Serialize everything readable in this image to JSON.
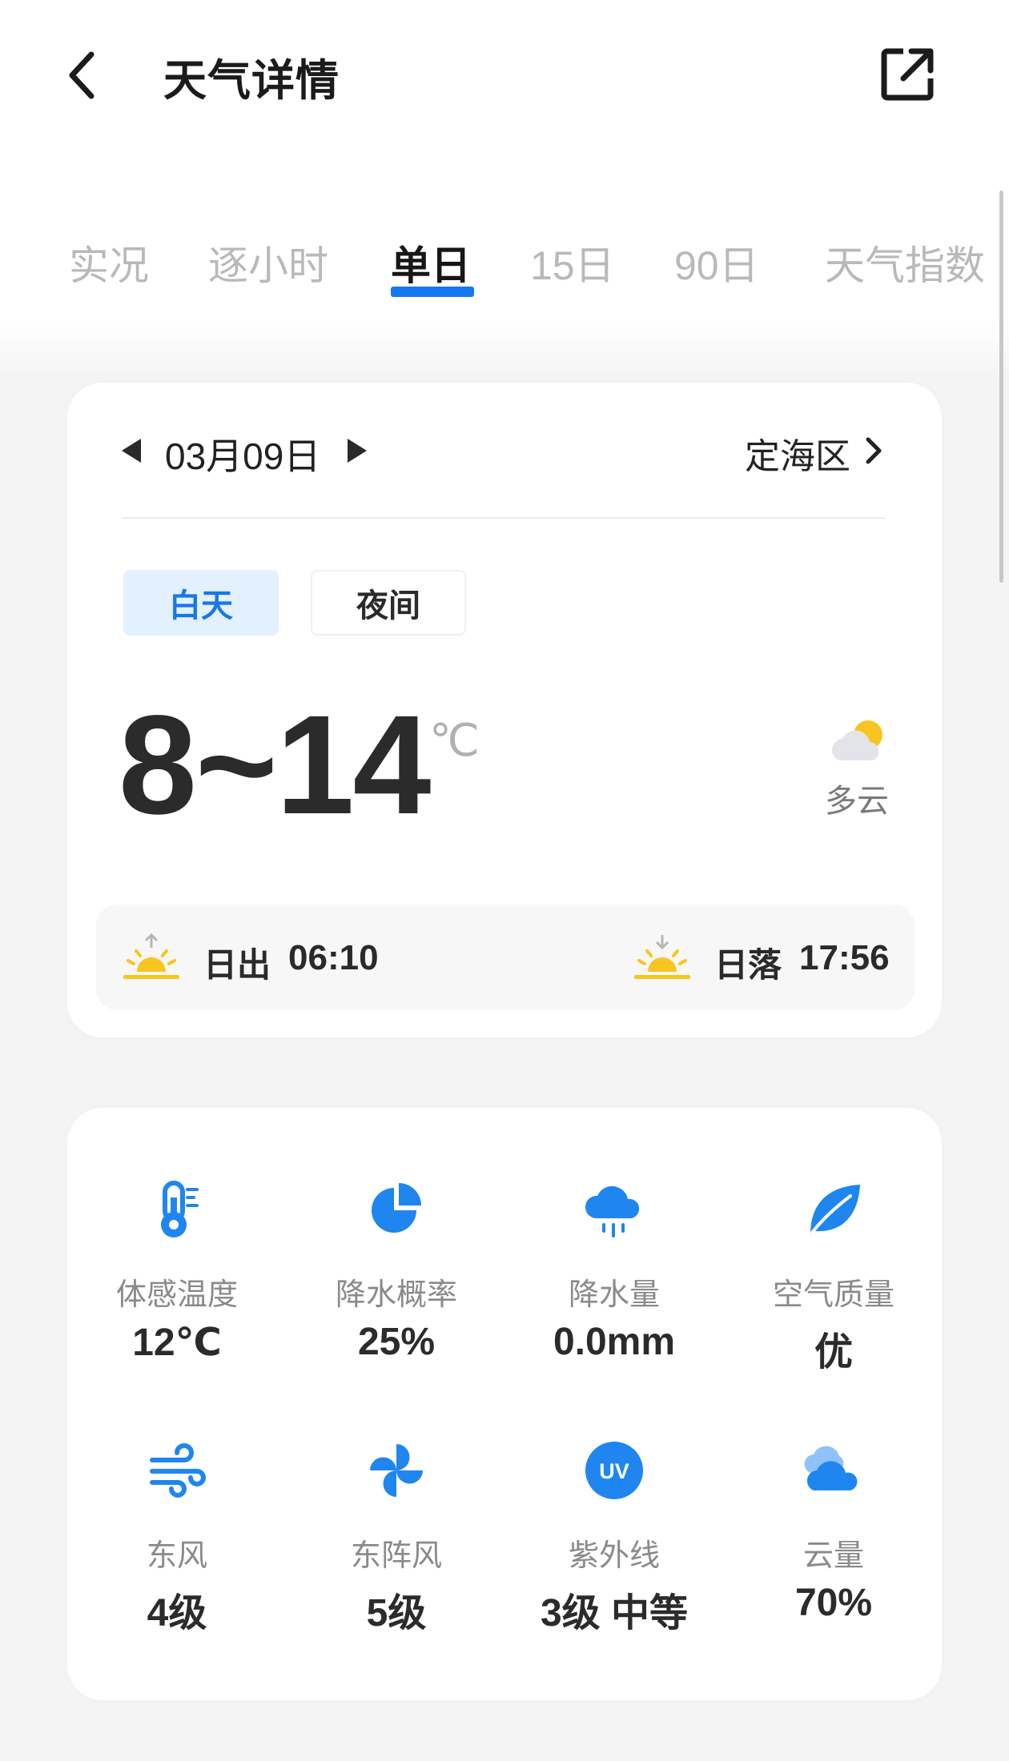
{
  "header": {
    "title": "天气详情"
  },
  "tabs": [
    {
      "label": "实况"
    },
    {
      "label": "逐小时"
    },
    {
      "label": "单日",
      "active": true
    },
    {
      "label": "15日"
    },
    {
      "label": "90日"
    },
    {
      "label": "天气指数"
    }
  ],
  "day_card": {
    "date": "03月09日",
    "location": "定海区",
    "segments": {
      "day": "白天",
      "night": "夜间",
      "selected": "白天"
    },
    "temperature_range": "8~14",
    "unit": "℃",
    "condition": "多云",
    "condition_icon": "partly-cloudy-icon",
    "sunrise": {
      "label": "日出",
      "time": "06:10"
    },
    "sunset": {
      "label": "日落",
      "time": "17:56"
    }
  },
  "details": [
    {
      "label": "体感温度",
      "value": "12℃",
      "icon": "thermometer-icon"
    },
    {
      "label": "降水概率",
      "value": "25%",
      "icon": "pie-chart-icon"
    },
    {
      "label": "降水量",
      "value": "0.0mm",
      "icon": "rain-cloud-icon"
    },
    {
      "label": "空气质量",
      "value": "优",
      "icon": "leaf-icon"
    },
    {
      "label": "东风",
      "value": "4级",
      "icon": "wind-icon"
    },
    {
      "label": "东阵风",
      "value": "5级",
      "icon": "pinwheel-icon"
    },
    {
      "label": "紫外线",
      "value": "3级 中等",
      "icon": "uv-icon",
      "uv_text": "UV"
    },
    {
      "label": "云量",
      "value": "70%",
      "icon": "cloud-icon"
    }
  ],
  "colors": {
    "accent": "#1678f0",
    "icon_blue": "#1f86f0",
    "sun_yellow": "#f8c520"
  }
}
